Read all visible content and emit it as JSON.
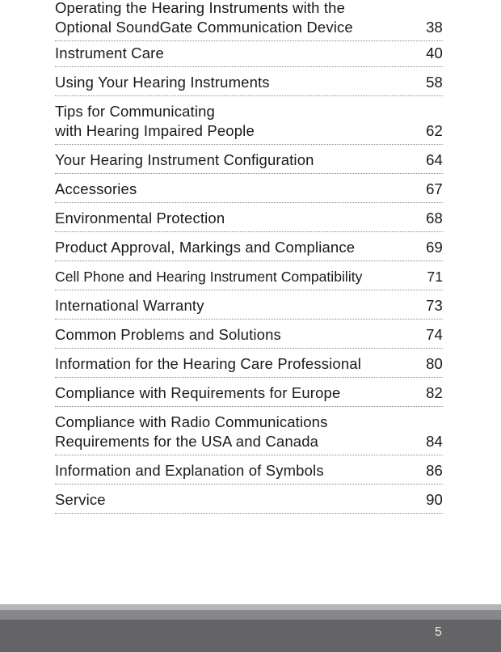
{
  "toc": {
    "entries": [
      {
        "title": "Operating the Hearing Instruments with the\nOptional SoundGate Communication Device",
        "page": "38"
      },
      {
        "title": "Instrument Care",
        "page": "40"
      },
      {
        "title": "Using Your Hearing Instruments",
        "page": "58"
      },
      {
        "title": "Tips for Communicating\nwith Hearing Impaired People",
        "page": "62"
      },
      {
        "title": "Your Hearing Instrument Configuration",
        "page": "64"
      },
      {
        "title": "Accessories",
        "page": "67"
      },
      {
        "title": "Environmental Protection",
        "page": "68"
      },
      {
        "title": "Product Approval, Markings and Compliance",
        "page": "69"
      },
      {
        "title": "Cell Phone and Hearing Instrument Compatibility",
        "page": "71"
      },
      {
        "title": "International Warranty",
        "page": "73"
      },
      {
        "title": "Common Problems and Solutions",
        "page": "74"
      },
      {
        "title": "Information for the Hearing Care Professional",
        "page": "80"
      },
      {
        "title": "Compliance with Requirements for Europe",
        "page": "82"
      },
      {
        "title": "Compliance with Radio Communications\nRequirements for the USA and Canada",
        "page": "84"
      },
      {
        "title": "Information and Explanation of Symbols",
        "page": "86"
      },
      {
        "title": "Service",
        "page": "90"
      }
    ]
  },
  "footer": {
    "page_number": "5"
  }
}
